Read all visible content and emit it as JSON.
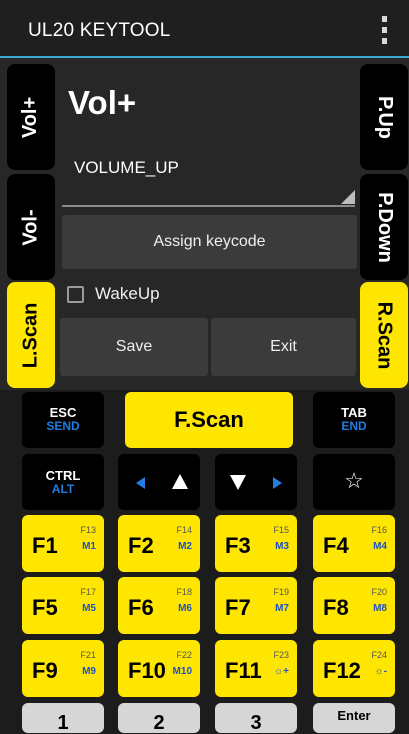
{
  "app": {
    "title": "UL20 KEYTOOL"
  },
  "side_keys": {
    "vol_up": "Vol+",
    "vol_down": "Vol-",
    "l_scan": "L.Scan",
    "p_up": "P.Up",
    "p_down": "P.Down",
    "r_scan": "R.Scan"
  },
  "editor": {
    "key_name": "Vol+",
    "keycode_value": "VOLUME_UP",
    "assign_label": "Assign keycode",
    "wakeup_label": "WakeUp",
    "wakeup_checked": false,
    "save_label": "Save",
    "exit_label": "Exit"
  },
  "keypad": {
    "esc": {
      "main": "ESC",
      "alt": "SEND"
    },
    "fscan": "F.Scan",
    "tab": {
      "main": "TAB",
      "alt": "END"
    },
    "ctrl": {
      "main": "CTRL",
      "alt": "ALT"
    },
    "star": "☆",
    "fkeys": [
      {
        "main": "F1",
        "sub1": "F13",
        "sub2": "M1"
      },
      {
        "main": "F2",
        "sub1": "F14",
        "sub2": "M2"
      },
      {
        "main": "F3",
        "sub1": "F15",
        "sub2": "M3"
      },
      {
        "main": "F4",
        "sub1": "F16",
        "sub2": "M4"
      },
      {
        "main": "F5",
        "sub1": "F17",
        "sub2": "M5"
      },
      {
        "main": "F6",
        "sub1": "F18",
        "sub2": "M6"
      },
      {
        "main": "F7",
        "sub1": "F19",
        "sub2": "M7"
      },
      {
        "main": "F8",
        "sub1": "F20",
        "sub2": "M8"
      },
      {
        "main": "F9",
        "sub1": "F21",
        "sub2": "M9"
      },
      {
        "main": "F10",
        "sub1": "F22",
        "sub2": "M10"
      },
      {
        "main": "F11",
        "sub1": "F23",
        "sub2": "☼+"
      },
      {
        "main": "F12",
        "sub1": "F24",
        "sub2": "☼-"
      }
    ],
    "bottom": [
      "1",
      "2",
      "3",
      "Enter"
    ]
  },
  "colors": {
    "accent": "#39a8d6",
    "key_yellow": "#ffe600",
    "key_black": "#000000",
    "alt_blue": "#1f7ee0"
  }
}
